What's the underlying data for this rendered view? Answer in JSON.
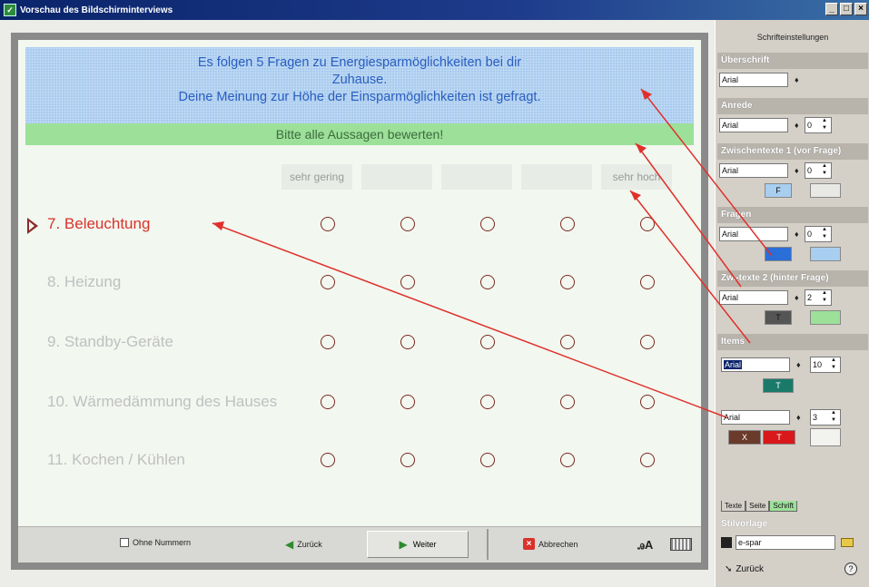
{
  "window": {
    "title": "Vorschau des Bildschirminterviews",
    "buttons": [
      "_",
      "□",
      "×"
    ]
  },
  "preview": {
    "header_lines": [
      "Es folgen 5 Fragen zu Energiesparmöglichkeiten bei dir",
      "Zuhause.",
      "Deine Meinung zur Höhe der Einsparmöglichkeiten ist gefragt."
    ],
    "subheader": "Bitte alle Aussagen bewerten!",
    "scale": [
      "sehr gering",
      "",
      "",
      "",
      "sehr hoch"
    ],
    "questions": [
      {
        "label": "7. Beleuchtung",
        "active": true
      },
      {
        "label": "8. Heizung",
        "active": false
      },
      {
        "label": "9. Standby-Geräte",
        "active": false
      },
      {
        "label": "10. Wärmedämmung des Hauses",
        "active": false
      },
      {
        "label": "11. Kochen / Kühlen",
        "active": false
      }
    ],
    "bottom": {
      "ohne_nummern": "Ohne Nummern",
      "zurueck": "Zurück",
      "weiter": "Weiter",
      "abbrechen": "Abbrechen"
    }
  },
  "panel": {
    "title": "Schrifteinstellungen",
    "sections": {
      "ueberschrift": "Überschrift",
      "anrede": "Anrede",
      "zwischentexte1": "Zwischentexte 1 (vor Frage)",
      "fragen": "Fragen",
      "zwtexte2": "Zw.-texte 2 (hinter Frage)",
      "items": "Items"
    },
    "font": "Arial",
    "sizes": {
      "anrede": "0",
      "zwischentexte1": "0",
      "fragen": "0",
      "zwtexte2": "2",
      "items": "10",
      "items2": "3"
    },
    "swatch_labels": {
      "f": "F",
      "t": "T",
      "x": "X"
    },
    "tabs": [
      "Texte",
      "Seite",
      "Schrift"
    ],
    "stilvorlage_label": "Stilvorlage",
    "stilvorlage_value": "e-spar",
    "back": "Zurück",
    "help": "?"
  }
}
